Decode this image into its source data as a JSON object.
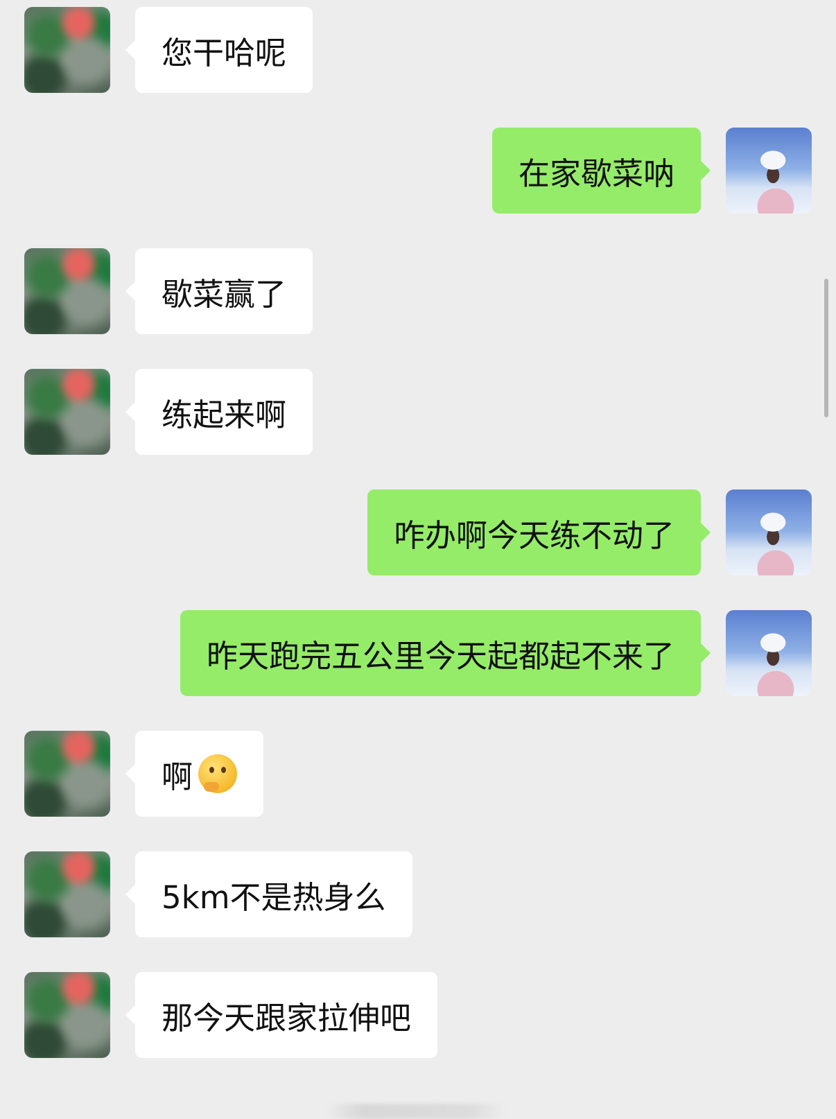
{
  "chat": {
    "messages": [
      {
        "side": "incoming",
        "text": "您干哈呢"
      },
      {
        "side": "outgoing",
        "text": "在家歇菜呐"
      },
      {
        "side": "incoming",
        "text": "歇菜赢了"
      },
      {
        "side": "incoming",
        "text": "练起来啊"
      },
      {
        "side": "outgoing",
        "text": "咋办啊今天练不动了"
      },
      {
        "side": "outgoing",
        "text": "昨天跑完五公里今天起都起不来了"
      },
      {
        "side": "incoming",
        "text": "啊",
        "emoji": "thinking-face"
      },
      {
        "side": "incoming",
        "text": "5km不是热身么"
      },
      {
        "side": "incoming",
        "text": "那今天跟家拉伸吧"
      }
    ]
  },
  "colors": {
    "background": "#ededed",
    "incoming_bubble": "#ffffff",
    "outgoing_bubble": "#95ec69"
  }
}
